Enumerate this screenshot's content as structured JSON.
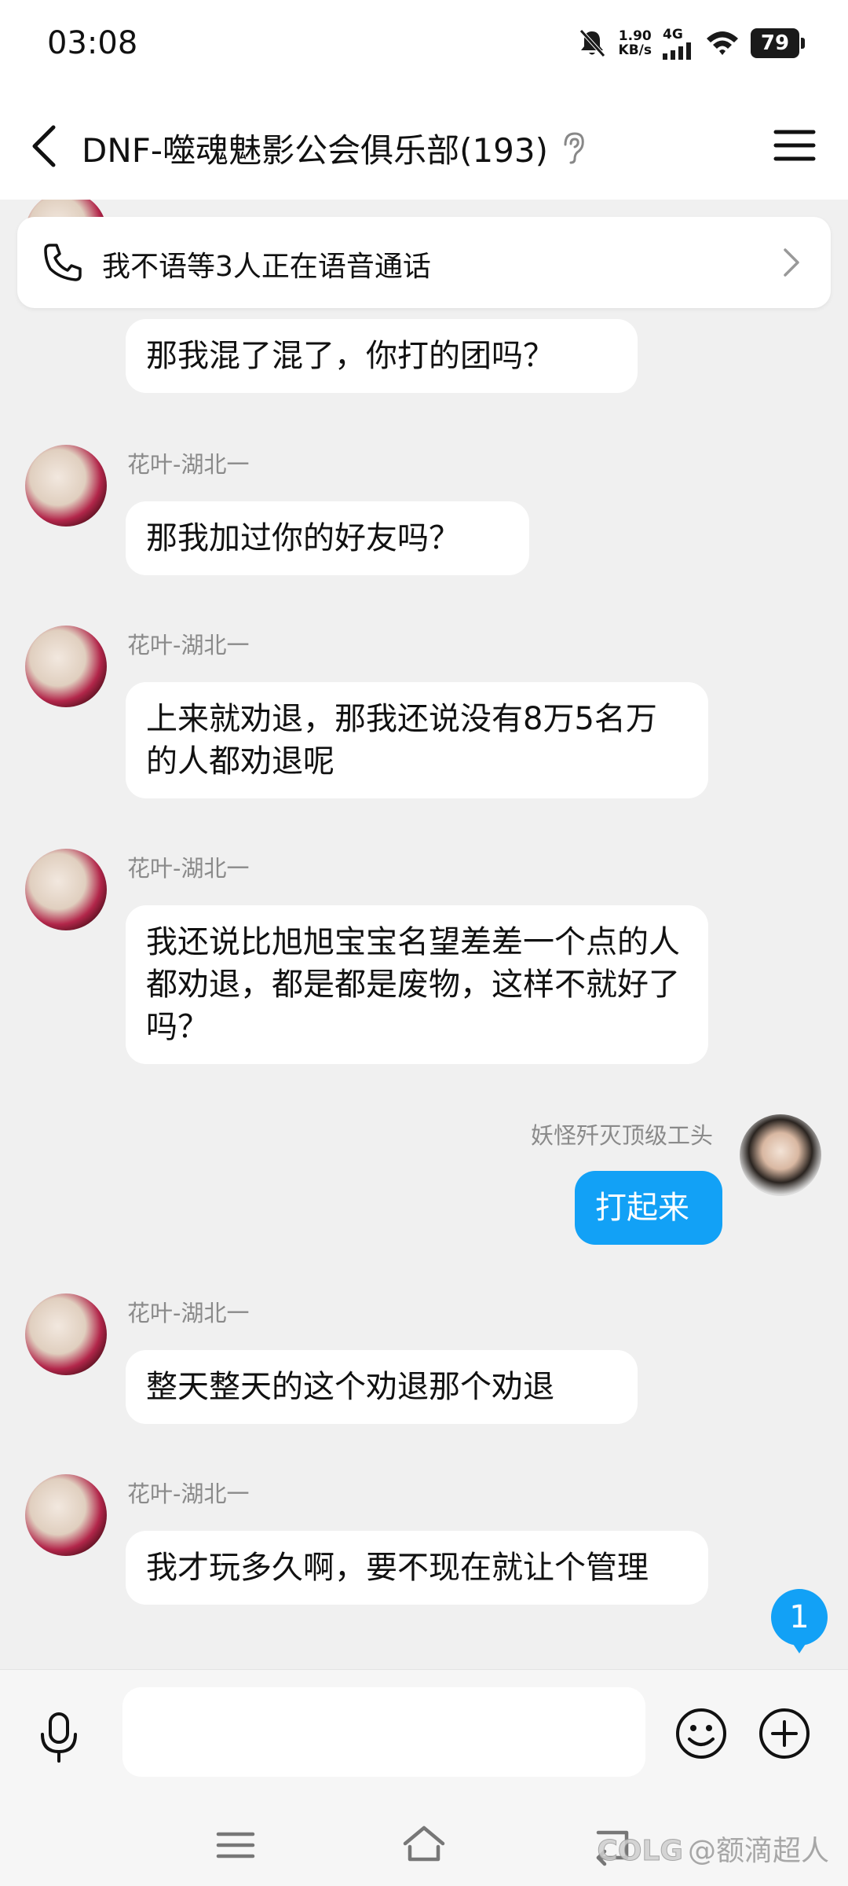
{
  "status_bar": {
    "time": "03:08",
    "net_speed_value": "1.90",
    "net_speed_unit": "KB/s",
    "net_type": "4G",
    "battery": "79",
    "icons": [
      "bell-muted-icon",
      "signal-icon",
      "wifi-icon",
      "battery-icon"
    ]
  },
  "header": {
    "title": "DNF-噬魂魅影公会俱乐部(193)",
    "icons": [
      "back-icon",
      "ear-icon",
      "menu-icon"
    ]
  },
  "call_banner": {
    "text": "我不语等3人正在语音通话",
    "icons": [
      "phone-icon",
      "chevron-right-icon"
    ]
  },
  "messages": [
    {
      "sender": "",
      "text": "那我混了混了，你打的团吗？",
      "mine": false
    },
    {
      "sender": "花叶-湖北一",
      "text": "那我加过你的好友吗？",
      "mine": false
    },
    {
      "sender": "花叶-湖北一",
      "text": "上来就劝退，那我还说没有8万5名万的人都劝退呢",
      "mine": false
    },
    {
      "sender": "花叶-湖北一",
      "text": "我还说比旭旭宝宝名望差差一个点的人都劝退，都是都是废物，这样不就好了吗？",
      "mine": false
    },
    {
      "sender": "妖怪歼灭顶级工头",
      "text": "打起来",
      "mine": true
    },
    {
      "sender": "花叶-湖北一",
      "text": "整天整天的这个劝退那个劝退",
      "mine": false
    },
    {
      "sender": "花叶-湖北一",
      "text": "我才玩多久啊，要不现在就让个管理",
      "mine": false
    }
  ],
  "unread_badge": "1",
  "input_bar": {
    "placeholder": "",
    "icons": [
      "mic-icon",
      "emoji-icon",
      "plus-icon"
    ]
  },
  "nav_bar": {
    "icons": [
      "recent-apps-icon",
      "home-icon",
      "back-nav-icon"
    ],
    "watermark_logo": "COLG",
    "watermark_text": "@额滴超人"
  },
  "colors": {
    "accent": "#12a1f6",
    "background": "#f0f0f0",
    "bubble": "#ffffff"
  }
}
